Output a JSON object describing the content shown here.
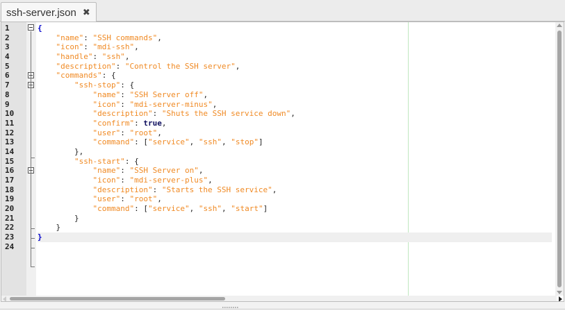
{
  "tab": {
    "title": "ssh-server.json",
    "close_glyph": "✖"
  },
  "line_numbers": [
    "1",
    "2",
    "3",
    "4",
    "5",
    "6",
    "7",
    "8",
    "9",
    "10",
    "11",
    "12",
    "13",
    "14",
    "15",
    "16",
    "17",
    "18",
    "19",
    "20",
    "21",
    "22",
    "23",
    "24"
  ],
  "code": {
    "line1_brace": "{",
    "line2": {
      "indent": "    ",
      "key": "\"name\"",
      "sep": ": ",
      "val": "\"SSH commands\"",
      "end": ","
    },
    "line3": {
      "indent": "    ",
      "key": "\"icon\"",
      "sep": ": ",
      "val": "\"mdi-ssh\"",
      "end": ","
    },
    "line4": {
      "indent": "    ",
      "key": "\"handle\"",
      "sep": ": ",
      "val": "\"ssh\"",
      "end": ","
    },
    "line5": {
      "indent": "    ",
      "key": "\"description\"",
      "sep": ": ",
      "val": "\"Control the SSH server\"",
      "end": ","
    },
    "line6": {
      "indent": "    ",
      "key": "\"commands\"",
      "sep": ": ",
      "end": "{"
    },
    "line7": {
      "indent": "        ",
      "key": "\"ssh-stop\"",
      "sep": ": ",
      "end": "{"
    },
    "line8": {
      "indent": "            ",
      "key": "\"name\"",
      "sep": ": ",
      "val": "\"SSH Server off\"",
      "end": ","
    },
    "line9": {
      "indent": "            ",
      "key": "\"icon\"",
      "sep": ": ",
      "val": "\"mdi-server-minus\"",
      "end": ","
    },
    "line10": {
      "indent": "            ",
      "key": "\"description\"",
      "sep": ": ",
      "val": "\"Shuts the SSH service down\"",
      "end": ","
    },
    "line11": {
      "indent": "            ",
      "key": "\"confirm\"",
      "sep": ": ",
      "kw": "true",
      "end": ","
    },
    "line12": {
      "indent": "            ",
      "key": "\"user\"",
      "sep": ": ",
      "val": "\"root\"",
      "end": ","
    },
    "line13": {
      "indent": "            ",
      "key": "\"command\"",
      "sep": ": [",
      "a1": "\"service\"",
      "c1": ", ",
      "a2": "\"ssh\"",
      "c2": ", ",
      "a3": "\"stop\"",
      "end": "]"
    },
    "line14": {
      "text": "        },"
    },
    "line15": {
      "indent": "        ",
      "key": "\"ssh-start\"",
      "sep": ": ",
      "end": "{"
    },
    "line16": {
      "indent": "            ",
      "key": "\"name\"",
      "sep": ": ",
      "val": "\"SSH Server on\"",
      "end": ","
    },
    "line17": {
      "indent": "            ",
      "key": "\"icon\"",
      "sep": ": ",
      "val": "\"mdi-server-plus\"",
      "end": ","
    },
    "line18": {
      "indent": "            ",
      "key": "\"description\"",
      "sep": ": ",
      "val": "\"Starts the SSH service\"",
      "end": ","
    },
    "line19": {
      "indent": "            ",
      "key": "\"user\"",
      "sep": ": ",
      "val": "\"root\"",
      "end": ","
    },
    "line20": {
      "indent": "            ",
      "key": "\"command\"",
      "sep": ": [",
      "a1": "\"service\"",
      "c1": ", ",
      "a2": "\"ssh\"",
      "c2": ", ",
      "a3": "\"start\"",
      "end": "]"
    },
    "line21": {
      "text": "        }"
    },
    "line22": {
      "text": "    }"
    },
    "line23_brace": "}",
    "line24": ""
  },
  "colors": {
    "string": "#f08a24",
    "bracket_match": "#0000cc",
    "keyword": "#10105f",
    "edge_line": "#bfe7bf",
    "gutter": "#e3e3e3"
  },
  "icons": {
    "close": "close-icon",
    "fold": "fold-minus-icon",
    "scroll_up": "scroll-up-arrow-icon",
    "scroll_down": "scroll-down-arrow-icon",
    "scroll_left": "scroll-left-arrow-icon",
    "scroll_right": "scroll-right-arrow-icon"
  }
}
